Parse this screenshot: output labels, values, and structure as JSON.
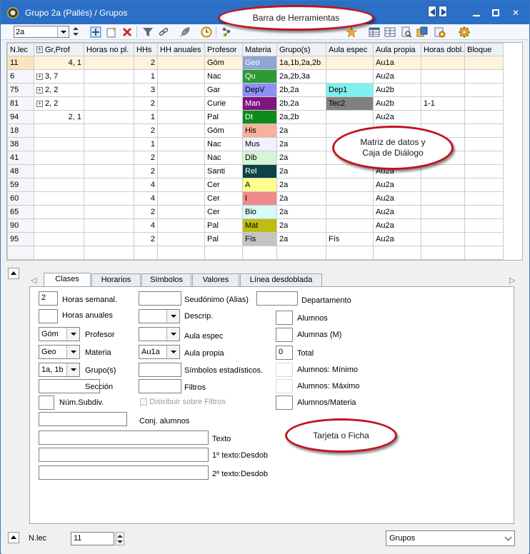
{
  "window": {
    "title": "Grupo 2a (Pallés) / Grupos",
    "controls": {
      "minimize": "minimize-icon",
      "maximize": "maximize-icon",
      "close": "✕"
    }
  },
  "toolbar": {
    "combo_value": "2a",
    "icons": [
      "add-icon",
      "new-sheet-icon",
      "delete-icon",
      "filter-icon",
      "link-icon",
      "rocket-icon",
      "clock-icon",
      "molecule-icon",
      "table-icon",
      "table-alt-icon",
      "print-preview-icon",
      "copy-icon",
      "settings-cog-icon",
      "gear-icon"
    ]
  },
  "callouts": {
    "toolbar": "Barra de Herramientas",
    "grid_line1": "Matriz de datos y",
    "grid_line2": "Caja de Diálogo",
    "card": "Tarjeta o Ficha"
  },
  "grid": {
    "headers": [
      "N.lec",
      "Gr,Prof",
      "Horas no pl.",
      "HHs",
      "HH anuales",
      "Profesor",
      "Materia",
      "Grupo(s)",
      "Aula espec",
      "Aula propia",
      "Horas dobl.",
      "Bloque"
    ],
    "rows": [
      {
        "nlec": "11",
        "grprof": "4, 1",
        "expand": false,
        "hhs": "2",
        "prof": "Góm",
        "mat": "Geo",
        "matColor": "#8fa6d2",
        "matText": "#ffffff",
        "grupos": "1a,1b,2a,2b",
        "aesp": "",
        "aespColor": "",
        "aprop": "Au1a",
        "hdobl": "",
        "sel": true
      },
      {
        "nlec": "6",
        "grprof": "3, 7",
        "expand": true,
        "hhs": "1",
        "prof": "Nac",
        "mat": "Qu",
        "matColor": "#2e9a33",
        "matText": "#ffffff",
        "grupos": "2a,2b,3a",
        "aesp": "",
        "aespColor": "",
        "aprop": "Au2a",
        "hdobl": ""
      },
      {
        "nlec": "75",
        "grprof": "2, 2",
        "expand": true,
        "hhs": "3",
        "prof": "Gar",
        "mat": "DepV",
        "matColor": "#8f8ff5",
        "matText": "#000000",
        "grupos": "2b,2a",
        "aesp": "Dep1",
        "aespColor": "#7ff0f0",
        "aprop": "Au2b",
        "hdobl": ""
      },
      {
        "nlec": "81",
        "grprof": "2, 2",
        "expand": true,
        "hhs": "2",
        "prof": "Curie",
        "mat": "Man",
        "matColor": "#7f157f",
        "matText": "#ffffff",
        "grupos": "2b,2a",
        "aesp": "Tec2",
        "aespColor": "#808080",
        "aprop": "Au2b",
        "hdobl": "1-1"
      },
      {
        "nlec": "94",
        "grprof": "2, 1",
        "expand": false,
        "hhs": "1",
        "prof": "Pal",
        "mat": "Dt",
        "matColor": "#0e8a18",
        "matText": "#ffffff",
        "grupos": "2a,2b",
        "aesp": "",
        "aespColor": "",
        "aprop": "Au2a",
        "hdobl": ""
      },
      {
        "nlec": "18",
        "grprof": "",
        "expand": false,
        "hhs": "2",
        "prof": "Góm",
        "mat": "His",
        "matColor": "#f6b29a",
        "matText": "#000000",
        "grupos": "2a",
        "aesp": "",
        "aespColor": "",
        "aprop": "",
        "hdobl": ""
      },
      {
        "nlec": "38",
        "grprof": "",
        "expand": false,
        "hhs": "1",
        "prof": "Nac",
        "mat": "Mus",
        "matColor": "#f1f1ff",
        "matText": "#000000",
        "grupos": "2a",
        "aesp": "",
        "aespColor": "",
        "aprop": "",
        "hdobl": ""
      },
      {
        "nlec": "41",
        "grprof": "",
        "expand": false,
        "hhs": "2",
        "prof": "Nac",
        "mat": "Dib",
        "matColor": "#d5f5d5",
        "matText": "#000000",
        "grupos": "2a",
        "aesp": "",
        "aespColor": "",
        "aprop": "",
        "hdobl": ""
      },
      {
        "nlec": "48",
        "grprof": "",
        "expand": false,
        "hhs": "2",
        "prof": "Santi",
        "mat": "Rel",
        "matColor": "#0b4444",
        "matText": "#ffffff",
        "grupos": "2a",
        "aesp": "",
        "aespColor": "",
        "aprop": "Au2a",
        "hdobl": ""
      },
      {
        "nlec": "59",
        "grprof": "",
        "expand": false,
        "hhs": "4",
        "prof": "Cer",
        "mat": "A",
        "matColor": "#ffff8a",
        "matText": "#000000",
        "grupos": "2a",
        "aesp": "",
        "aespColor": "",
        "aprop": "Au2a",
        "hdobl": ""
      },
      {
        "nlec": "60",
        "grprof": "",
        "expand": false,
        "hhs": "4",
        "prof": "Cer",
        "mat": "I",
        "matColor": "#f08a8a",
        "matText": "#000000",
        "grupos": "2a",
        "aesp": "",
        "aespColor": "",
        "aprop": "Au2a",
        "hdobl": ""
      },
      {
        "nlec": "65",
        "grprof": "",
        "expand": false,
        "hhs": "2",
        "prof": "Cer",
        "mat": "Bio",
        "matColor": "#d4fafa",
        "matText": "#000000",
        "grupos": "2a",
        "aesp": "",
        "aespColor": "",
        "aprop": "Au2a",
        "hdobl": ""
      },
      {
        "nlec": "90",
        "grprof": "",
        "expand": false,
        "hhs": "4",
        "prof": "Pal",
        "mat": "Mat",
        "matColor": "#bdbd12",
        "matText": "#000000",
        "grupos": "2a",
        "aesp": "",
        "aespColor": "",
        "aprop": "Au2a",
        "hdobl": ""
      },
      {
        "nlec": "95",
        "grprof": "",
        "expand": false,
        "hhs": "2",
        "prof": "Pal",
        "mat": "Fís",
        "matColor": "#c3c3c3",
        "matText": "#000000",
        "grupos": "2a",
        "aesp": "Fís",
        "aespColor": "",
        "aprop": "Au2a",
        "hdobl": ""
      }
    ]
  },
  "tabs": [
    "Clases",
    "Horarios",
    "Símbolos",
    "Valores",
    "Línea desdoblada"
  ],
  "form": {
    "horas_semanal": {
      "label": "Horas semanal.",
      "value": "2"
    },
    "horas_anuales": {
      "label": "Horas anuales",
      "value": ""
    },
    "profesor": {
      "label": "Profesor",
      "value": "Góm"
    },
    "materia": {
      "label": "Materia",
      "value": "Geo"
    },
    "grupos": {
      "label": "Grupo(s)",
      "value": "1a, 1b"
    },
    "seccion": {
      "label": "Sección",
      "value": ""
    },
    "num_subdiv": {
      "label": "Núm.Subdiv.",
      "value": ""
    },
    "conj_alumnos": {
      "label": "Conj. alumnos",
      "value": ""
    },
    "seudonimo": {
      "label": "Seudónimo (Alias)",
      "value": ""
    },
    "descrip": {
      "label": "Descrip.",
      "value": ""
    },
    "aula_espec": {
      "label": "Aula espec",
      "value": ""
    },
    "aula_propia": {
      "label": "Aula propia",
      "value": "Au1a"
    },
    "simbolos": {
      "label": "Símbolos estadísticos.",
      "value": ""
    },
    "filtros": {
      "label": "Filtros",
      "value": ""
    },
    "distribuir": {
      "label": "Distribuir sobre Filtros"
    },
    "departamento": {
      "label": "Departamento",
      "value": ""
    },
    "alumnos": {
      "label": "Alumnos",
      "value": ""
    },
    "alumnas": {
      "label": "Alumnas (M)",
      "value": ""
    },
    "total": {
      "label": "Total",
      "value": "0"
    },
    "al_min": {
      "label": "Alumnos: Mínimo",
      "value": ""
    },
    "al_max": {
      "label": "Alumnos: Máximo",
      "value": ""
    },
    "al_mat": {
      "label": "Alumnos/Materia",
      "value": ""
    },
    "texto": {
      "label": "Texto",
      "value": ""
    },
    "texto1": {
      "label": "1º texto:Desdob",
      "value": ""
    },
    "texto2": {
      "label": "2º texto:Desdob",
      "value": ""
    }
  },
  "status": {
    "label": "N.lec",
    "value": "11",
    "view": "Grupos"
  }
}
